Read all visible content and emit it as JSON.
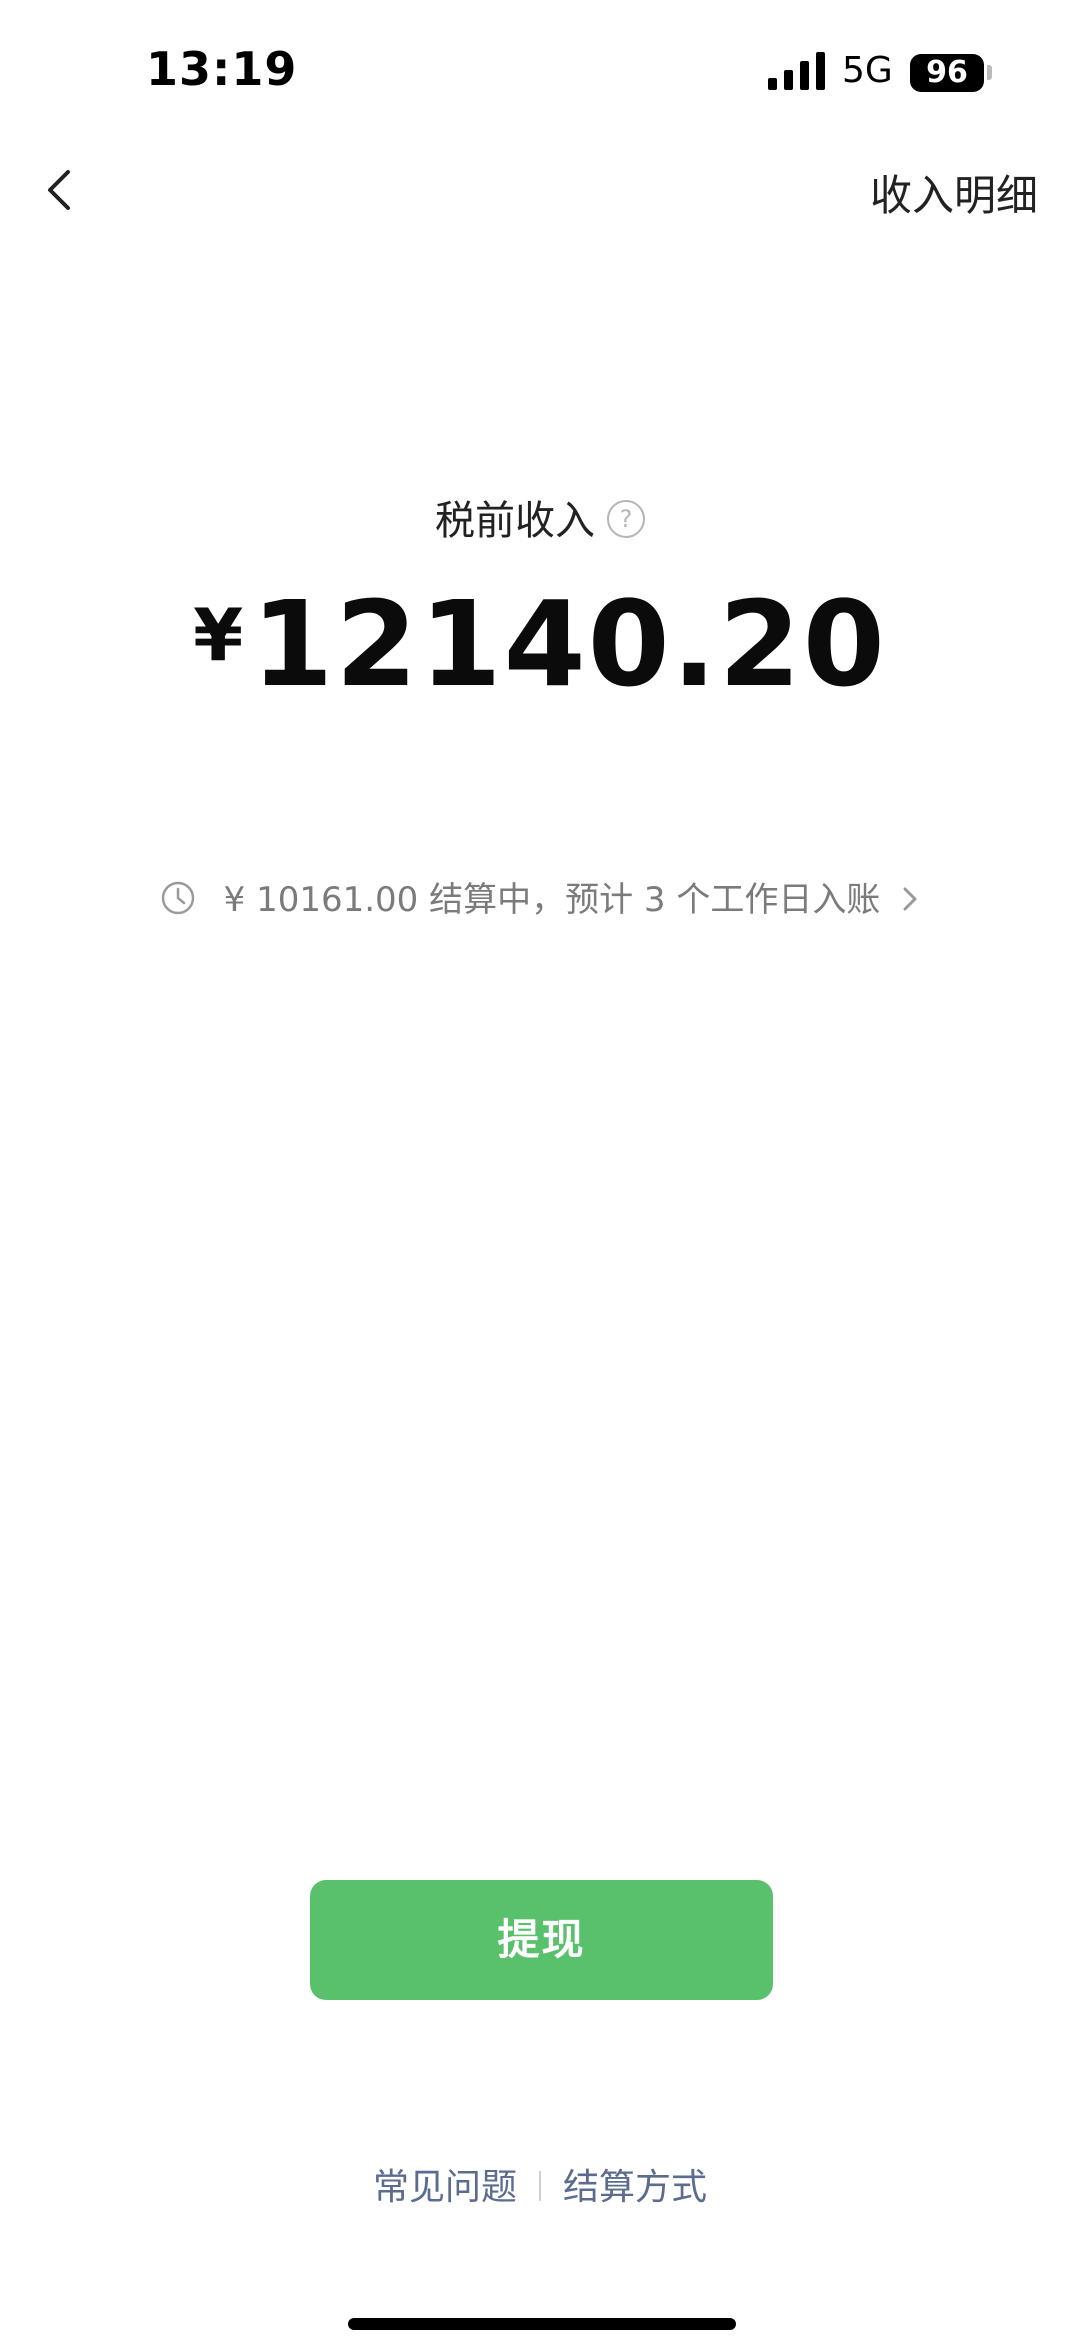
{
  "status_bar": {
    "time": "13:19",
    "network": "5G",
    "battery": "96"
  },
  "nav": {
    "right_label": "收入明细"
  },
  "income": {
    "label": "税前收入",
    "help": "?",
    "currency": "¥",
    "amount": "12140.20"
  },
  "pending": {
    "text": "¥ 10161.00 结算中，预计 3 个工作日入账"
  },
  "actions": {
    "withdraw_label": "提现"
  },
  "footer": {
    "faq_label": "常见问题",
    "settlement_label": "结算方式"
  },
  "colors": {
    "accent_green": "#59c06c",
    "link_blue_gray": "#5b6c8f"
  }
}
